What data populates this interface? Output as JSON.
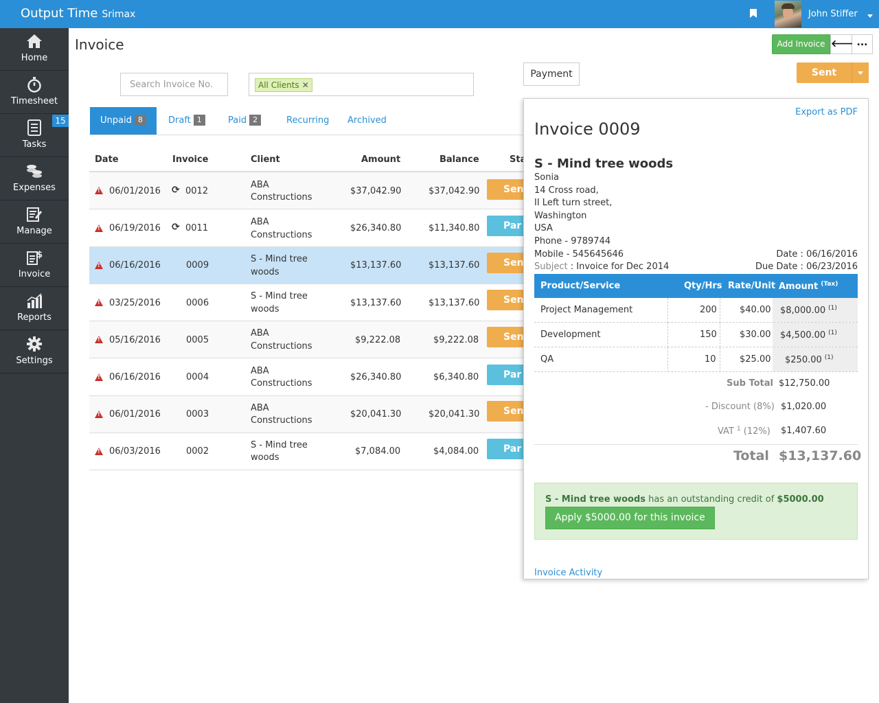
{
  "app": {
    "title": "Output Time",
    "org": "Srimax",
    "user_name": "John Stiffer"
  },
  "sidebar": {
    "items": [
      {
        "label": "Home",
        "icon": "home-icon"
      },
      {
        "label": "Timesheet",
        "icon": "stopwatch-icon"
      },
      {
        "label": "Tasks",
        "icon": "tasks-icon",
        "badge": "15"
      },
      {
        "label": "Expenses",
        "icon": "coins-icon"
      },
      {
        "label": "Manage",
        "icon": "manage-icon"
      },
      {
        "label": "Invoice",
        "icon": "invoice-icon"
      },
      {
        "label": "Reports",
        "icon": "reports-icon"
      },
      {
        "label": "Settings",
        "icon": "gear-icon"
      }
    ]
  },
  "page": {
    "title": "Invoice",
    "add_invoice": "Add Invoice",
    "back": "🡐",
    "more": "...",
    "search_placeholder": "Search Invoice No.",
    "client_filter": "All Clients",
    "payment": "Payment",
    "status_button": "Sent"
  },
  "tabs": [
    {
      "label": "Unpaid",
      "count": "8"
    },
    {
      "label": "Draft",
      "count": "1"
    },
    {
      "label": "Paid",
      "count": "2"
    },
    {
      "label": "Recurring"
    },
    {
      "label": "Archived"
    }
  ],
  "table": {
    "headers": [
      "Date",
      "Invoice",
      "Client",
      "Amount",
      "Balance",
      "Sta"
    ],
    "rows": [
      {
        "date": "06/01/2016",
        "invoice": "0012",
        "recurring": true,
        "client1": "ABA",
        "client2": "Constructions",
        "amount": "$37,042.90",
        "balance": "$37,042.90",
        "status": "Sent"
      },
      {
        "date": "06/19/2016",
        "invoice": "0011",
        "recurring": true,
        "client1": "ABA",
        "client2": "Constructions",
        "amount": "$26,340.80",
        "balance": "$11,340.80",
        "status": "Par"
      },
      {
        "date": "06/16/2016",
        "invoice": "0009",
        "recurring": false,
        "client1": "S - Mind tree",
        "client2": "woods",
        "amount": "$13,137.60",
        "balance": "$13,137.60",
        "status": "Sent"
      },
      {
        "date": "03/25/2016",
        "invoice": "0006",
        "recurring": false,
        "client1": "S - Mind tree",
        "client2": "woods",
        "amount": "$13,137.60",
        "balance": "$13,137.60",
        "status": "Sent"
      },
      {
        "date": "05/16/2016",
        "invoice": "0005",
        "recurring": false,
        "client1": "ABA",
        "client2": "Constructions",
        "amount": "$9,222.08",
        "balance": "$9,222.08",
        "status": "Sent"
      },
      {
        "date": "06/16/2016",
        "invoice": "0004",
        "recurring": false,
        "client1": "ABA",
        "client2": "Constructions",
        "amount": "$26,340.80",
        "balance": "$6,340.80",
        "status": "Par"
      },
      {
        "date": "06/01/2016",
        "invoice": "0003",
        "recurring": false,
        "client1": "ABA",
        "client2": "Constructions",
        "amount": "$20,041.30",
        "balance": "$20,041.30",
        "status": "Sent"
      },
      {
        "date": "06/03/2016",
        "invoice": "0002",
        "recurring": false,
        "client1": "S - Mind tree",
        "client2": "woods",
        "amount": "$7,084.00",
        "balance": "$4,084.00",
        "status": "Par"
      }
    ]
  },
  "detail": {
    "export": "Export as PDF",
    "title": "Invoice 0009",
    "client": "S - Mind tree woods",
    "address": [
      "Sonia",
      "14 Cross road,",
      "II Left turn street,",
      "Washington",
      "USA",
      "Phone - 9789744",
      "Mobile - 545645646"
    ],
    "date_label": "Date :",
    "date": "06/16/2016",
    "due_label": "Due Date :",
    "due_date": "06/23/2016",
    "subject_label": "Subject",
    "subject": ": Invoice for Dec 2014",
    "items_header": {
      "product": "Product/Service",
      "qty": "Qty/Hrs",
      "rate": "Rate/Unit",
      "amount": "Amount",
      "tax": "(Tax)"
    },
    "items": [
      {
        "name": "Project Management",
        "qty": "200",
        "rate": "$40.00",
        "amount": "$8,000.00",
        "tax": "(1)"
      },
      {
        "name": "Development",
        "qty": "150",
        "rate": "$30.00",
        "amount": "$4,500.00",
        "tax": "(1)"
      },
      {
        "name": "QA",
        "qty": "10",
        "rate": "$25.00",
        "amount": "$250.00",
        "tax": "(1)"
      }
    ],
    "subtotal_label": "Sub Total",
    "subtotal": "$12,750.00",
    "discount_label": "- Discount (8%)",
    "discount": "$1,020.00",
    "vat_label": "VAT",
    "vat_sup": "1",
    "vat_pct": "(12%)",
    "vat": "$1,407.60",
    "total_label": "Total",
    "total": "$13,137.60",
    "credit_client": "S - Mind tree woods",
    "credit_text": "has an outstanding credit of",
    "credit_amount": "$5000.00",
    "apply": "Apply $5000.00 for this invoice",
    "activity": "Invoice Activity"
  },
  "colors": {
    "primary": "#2a8fd6",
    "sidebar": "#353a3f",
    "success": "#5cb85c",
    "warning": "#f0ad4e",
    "info": "#5bc0de",
    "danger": "#c9302c"
  }
}
